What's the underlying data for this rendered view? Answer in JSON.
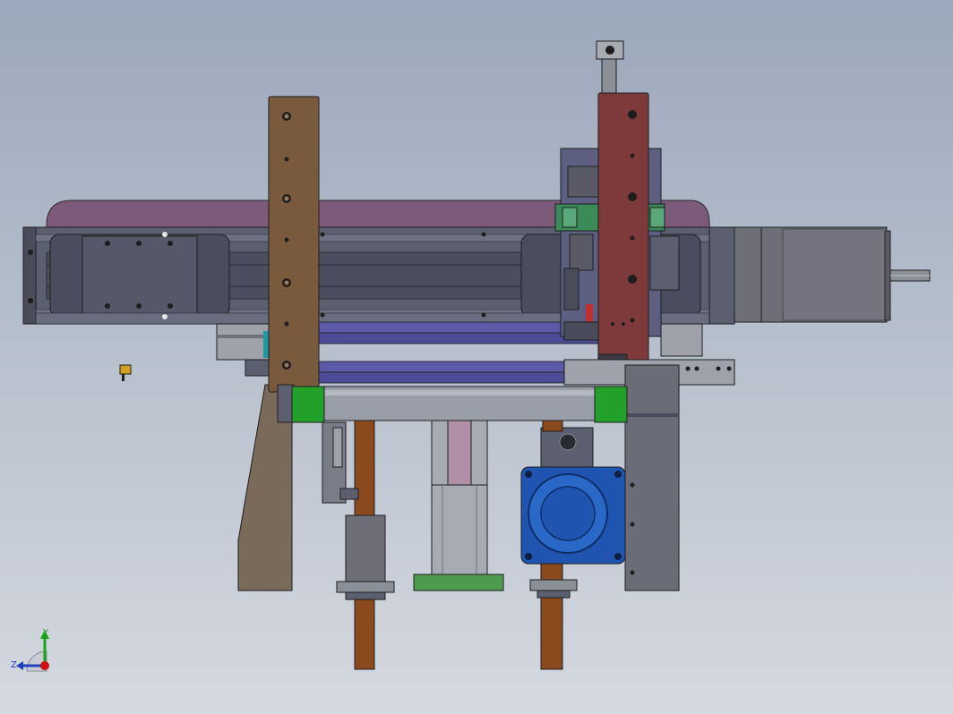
{
  "viewport": {
    "background_top": "#9ba8bb",
    "background_bottom": "#d5d9e0"
  },
  "triad": {
    "y_label": "Y",
    "z_label": "Z",
    "y_color": "#1aa31a",
    "z_color": "#1f3fbf",
    "origin_color": "#cc1111"
  },
  "colors": {
    "frame_gray": "#5c5f70",
    "rail_dark": "#3f4150",
    "rail_mid": "#6b6e80",
    "purple_cover": "#7d5a7a",
    "brown_plate": "#7a5a3c",
    "red_plate": "#7e3a3a",
    "motor_gray": "#6e6e78",
    "green_roller": "#22a02a",
    "blue_motor": "#1f55b0",
    "copper_shaft": "#8a4a1e",
    "indigo_rods": "#5a5aa8",
    "bright_green_base": "#4e9a4e"
  }
}
